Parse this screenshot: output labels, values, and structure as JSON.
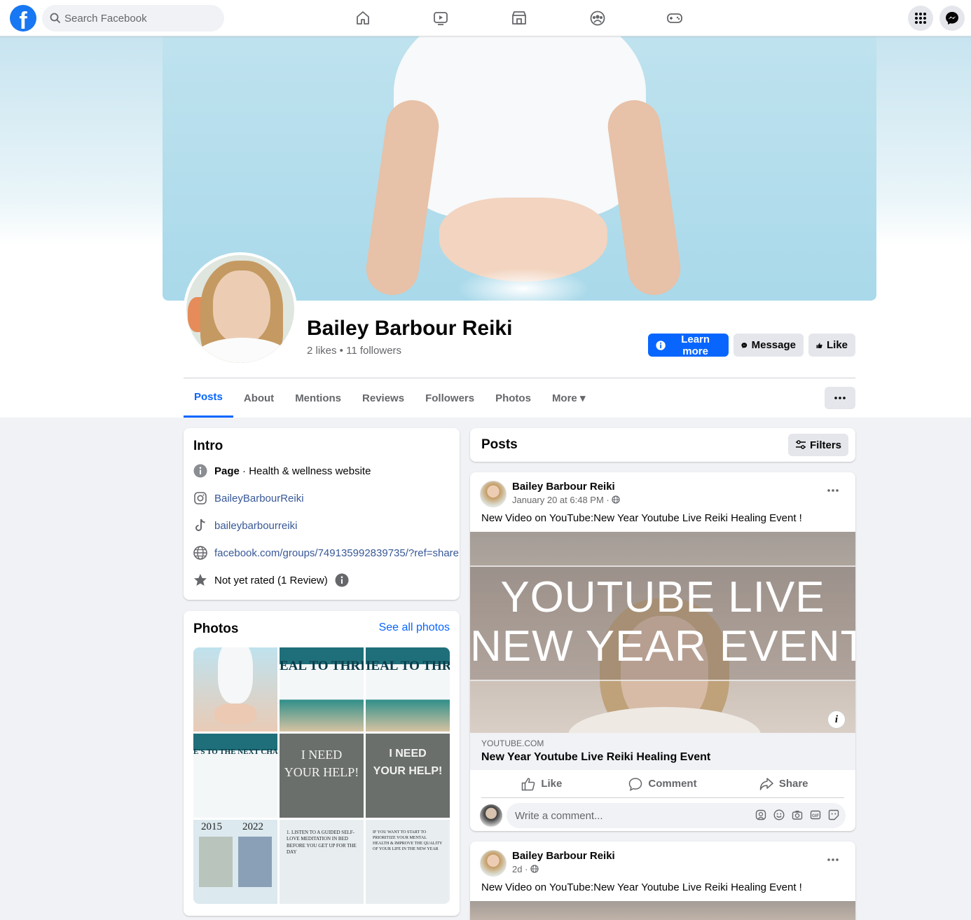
{
  "topbar": {
    "logo": "f",
    "search_placeholder": "Search Facebook",
    "nav_icons": [
      "home-icon",
      "video-icon",
      "marketplace-icon",
      "groups-icon",
      "gaming-icon"
    ],
    "right_icons": [
      "menu-grid-icon",
      "messenger-icon"
    ]
  },
  "profile": {
    "name": "Bailey Barbour Reiki",
    "stats": "2 likes • 11 followers",
    "buttons": {
      "learn_more": "Learn more",
      "message": "Message",
      "like": "Like"
    },
    "accent_color": "#0866ff"
  },
  "tabs": [
    {
      "label": "Posts",
      "active": true
    },
    {
      "label": "About"
    },
    {
      "label": "Mentions"
    },
    {
      "label": "Reviews"
    },
    {
      "label": "Followers"
    },
    {
      "label": "Photos"
    },
    {
      "label": "More ▾"
    }
  ],
  "intro": {
    "title": "Intro",
    "page_label": "Page",
    "category": " · Health & wellness website",
    "instagram": "BaileyBarbourReiki",
    "tiktok": "baileybarbourreiki",
    "website": "facebook.com/groups/749135992839735/?ref=share",
    "rating": "Not yet rated (1 Review)"
  },
  "photos": {
    "title": "Photos",
    "see_all": "See all photos",
    "heal_text": "EAL TO THRIV",
    "heal_text_2": "IEAL TO THRIV",
    "next_chap": "E'S TO THE NEXT CHAP",
    "need_1": "I NEED",
    "help_1": "YOUR HELP!",
    "need_2": "I NEED",
    "help_2": "YOUR HELP!",
    "year_1": "2015",
    "year_2": "2022",
    "note_1": "1. LISTEN TO A GUIDED SELF-LOVE MEDITATION IN BED BEFORE YOU GET UP FOR THE DAY",
    "note_2": "IF YOU WANT TO START TO PRIORITIZE YOUR MENTAL HEALTH & IMPROVE THE QUALITY OF YOUR LIFE IN THE NEW YEAR"
  },
  "posts_header": {
    "title": "Posts",
    "filters": "Filters"
  },
  "posts": [
    {
      "author": "Bailey Barbour Reiki",
      "time": "January 20 at 6:48 PM · ",
      "text": "New Video on YouTube:New Year Youtube Live Reiki Healing Event !",
      "thumb_line1": "YOUTUBE LIVE",
      "thumb_line2": "NEW YEAR EVENT",
      "link_domain": "YOUTUBE.COM",
      "link_title": "New Year Youtube Live Reiki Healing Event",
      "actions": {
        "like": "Like",
        "comment": "Comment",
        "share": "Share"
      },
      "comment_placeholder": "Write a comment..."
    },
    {
      "author": "Bailey Barbour Reiki",
      "time": "2d · ",
      "text": "New Video on YouTube:New Year Youtube Live Reiki Healing Event !"
    }
  ]
}
